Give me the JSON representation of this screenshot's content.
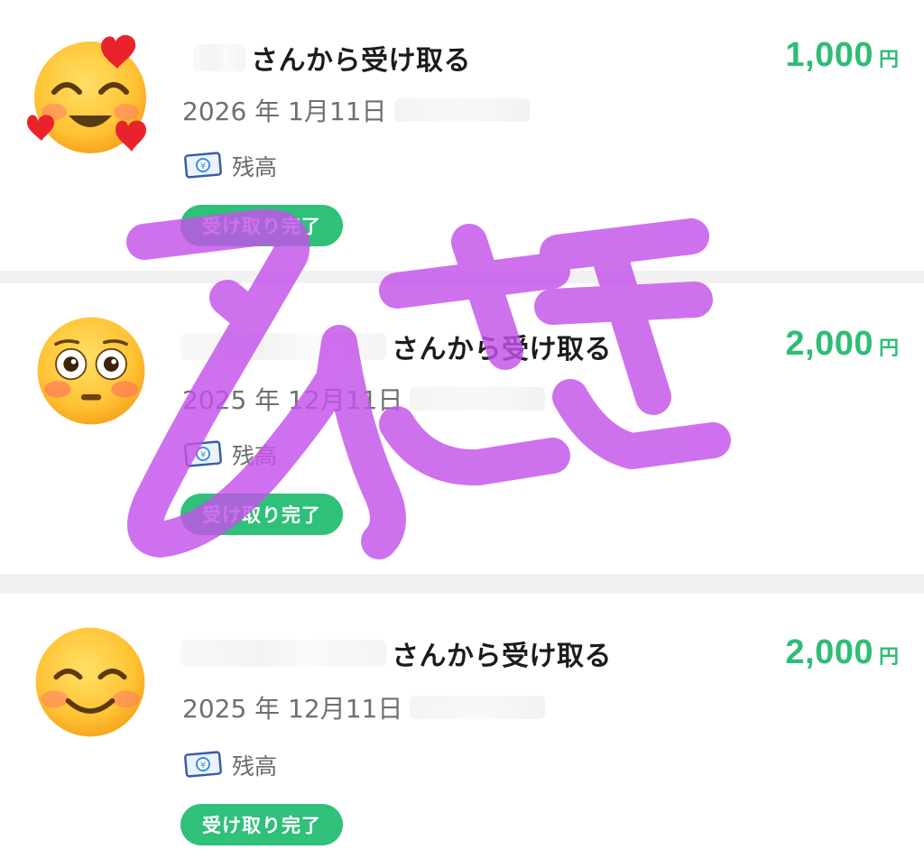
{
  "colors": {
    "accent": "#2fc07a",
    "amount": "#2ebd74",
    "scribble": "#c452ea"
  },
  "transactions": [
    {
      "name_suffix": "さんから受け取る",
      "date": "2026 年 1月11日",
      "source_label": "残高",
      "source_icon": "yen-bill-icon",
      "status": "受け取り完了",
      "amount": "1,000",
      "currency": "円",
      "avatar": "smiling-face-with-hearts-emoji"
    },
    {
      "name_suffix": "さんから受け取る",
      "date": "2025 年 12月11日",
      "source_label": "残高",
      "source_icon": "yen-bill-icon",
      "status": "受け取り完了",
      "amount": "2,000",
      "currency": "円",
      "avatar": "flushed-face-emoji"
    },
    {
      "name_suffix": "さんから受け取る",
      "date": "2025 年 12月11日",
      "source_label": "残高",
      "source_icon": "yen-bill-icon",
      "status": "受け取り完了",
      "amount": "2,000",
      "currency": "円",
      "avatar": "smiling-face-emoji"
    }
  ],
  "overlay": {
    "handwriting": "みさき"
  }
}
